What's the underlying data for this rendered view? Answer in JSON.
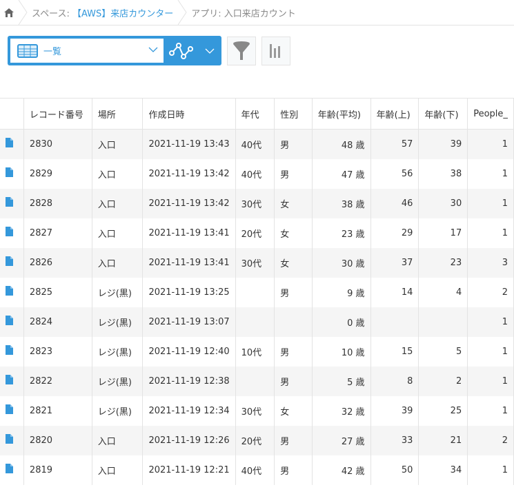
{
  "breadcrumb": {
    "home_icon": "home-icon",
    "space_prefix": "スペース: ",
    "space_name": "【AWS】来店カウンター",
    "app": "アプリ: 入口来店カウント"
  },
  "toolbar": {
    "view_icon": "table-view-icon",
    "view_label": "一覧",
    "graph_icon": "graph-icon",
    "filter_icon": "filter-icon",
    "chart_icon": "bar-chart-icon"
  },
  "colors": {
    "accent": "#3498db",
    "row_alt": "#f5f5f5",
    "border": "#e3e3e3"
  },
  "table": {
    "headers": [
      "レコード番号",
      "場所",
      "作成日時",
      "年代",
      "性別",
      "年齢(平均)",
      "年齢(上)",
      "年齢(下)",
      "People_"
    ],
    "rows": [
      [
        "2830",
        "入口",
        "2021-11-19 13:43",
        "40代",
        "男",
        "48 歳",
        "57",
        "39",
        "1"
      ],
      [
        "2829",
        "入口",
        "2021-11-19 13:42",
        "40代",
        "男",
        "47 歳",
        "56",
        "38",
        "1"
      ],
      [
        "2828",
        "入口",
        "2021-11-19 13:42",
        "30代",
        "女",
        "38 歳",
        "46",
        "30",
        "1"
      ],
      [
        "2827",
        "入口",
        "2021-11-19 13:41",
        "20代",
        "女",
        "23 歳",
        "29",
        "17",
        "1"
      ],
      [
        "2826",
        "入口",
        "2021-11-19 13:41",
        "30代",
        "女",
        "30 歳",
        "37",
        "23",
        "3"
      ],
      [
        "2825",
        "レジ(黒)",
        "2021-11-19 13:25",
        "",
        "男",
        "9 歳",
        "14",
        "4",
        "2"
      ],
      [
        "2824",
        "レジ(黒)",
        "2021-11-19 13:07",
        "",
        "",
        "0 歳",
        "",
        "",
        "1"
      ],
      [
        "2823",
        "レジ(黒)",
        "2021-11-19 12:40",
        "10代",
        "男",
        "10 歳",
        "15",
        "5",
        "1"
      ],
      [
        "2822",
        "レジ(黒)",
        "2021-11-19 12:38",
        "",
        "男",
        "5 歳",
        "8",
        "2",
        "1"
      ],
      [
        "2821",
        "レジ(黒)",
        "2021-11-19 12:34",
        "30代",
        "女",
        "32 歳",
        "39",
        "25",
        "1"
      ],
      [
        "2820",
        "入口",
        "2021-11-19 12:26",
        "20代",
        "男",
        "27 歳",
        "33",
        "21",
        "2"
      ],
      [
        "2819",
        "入口",
        "2021-11-19 12:21",
        "40代",
        "男",
        "42 歳",
        "50",
        "34",
        "1"
      ]
    ]
  }
}
